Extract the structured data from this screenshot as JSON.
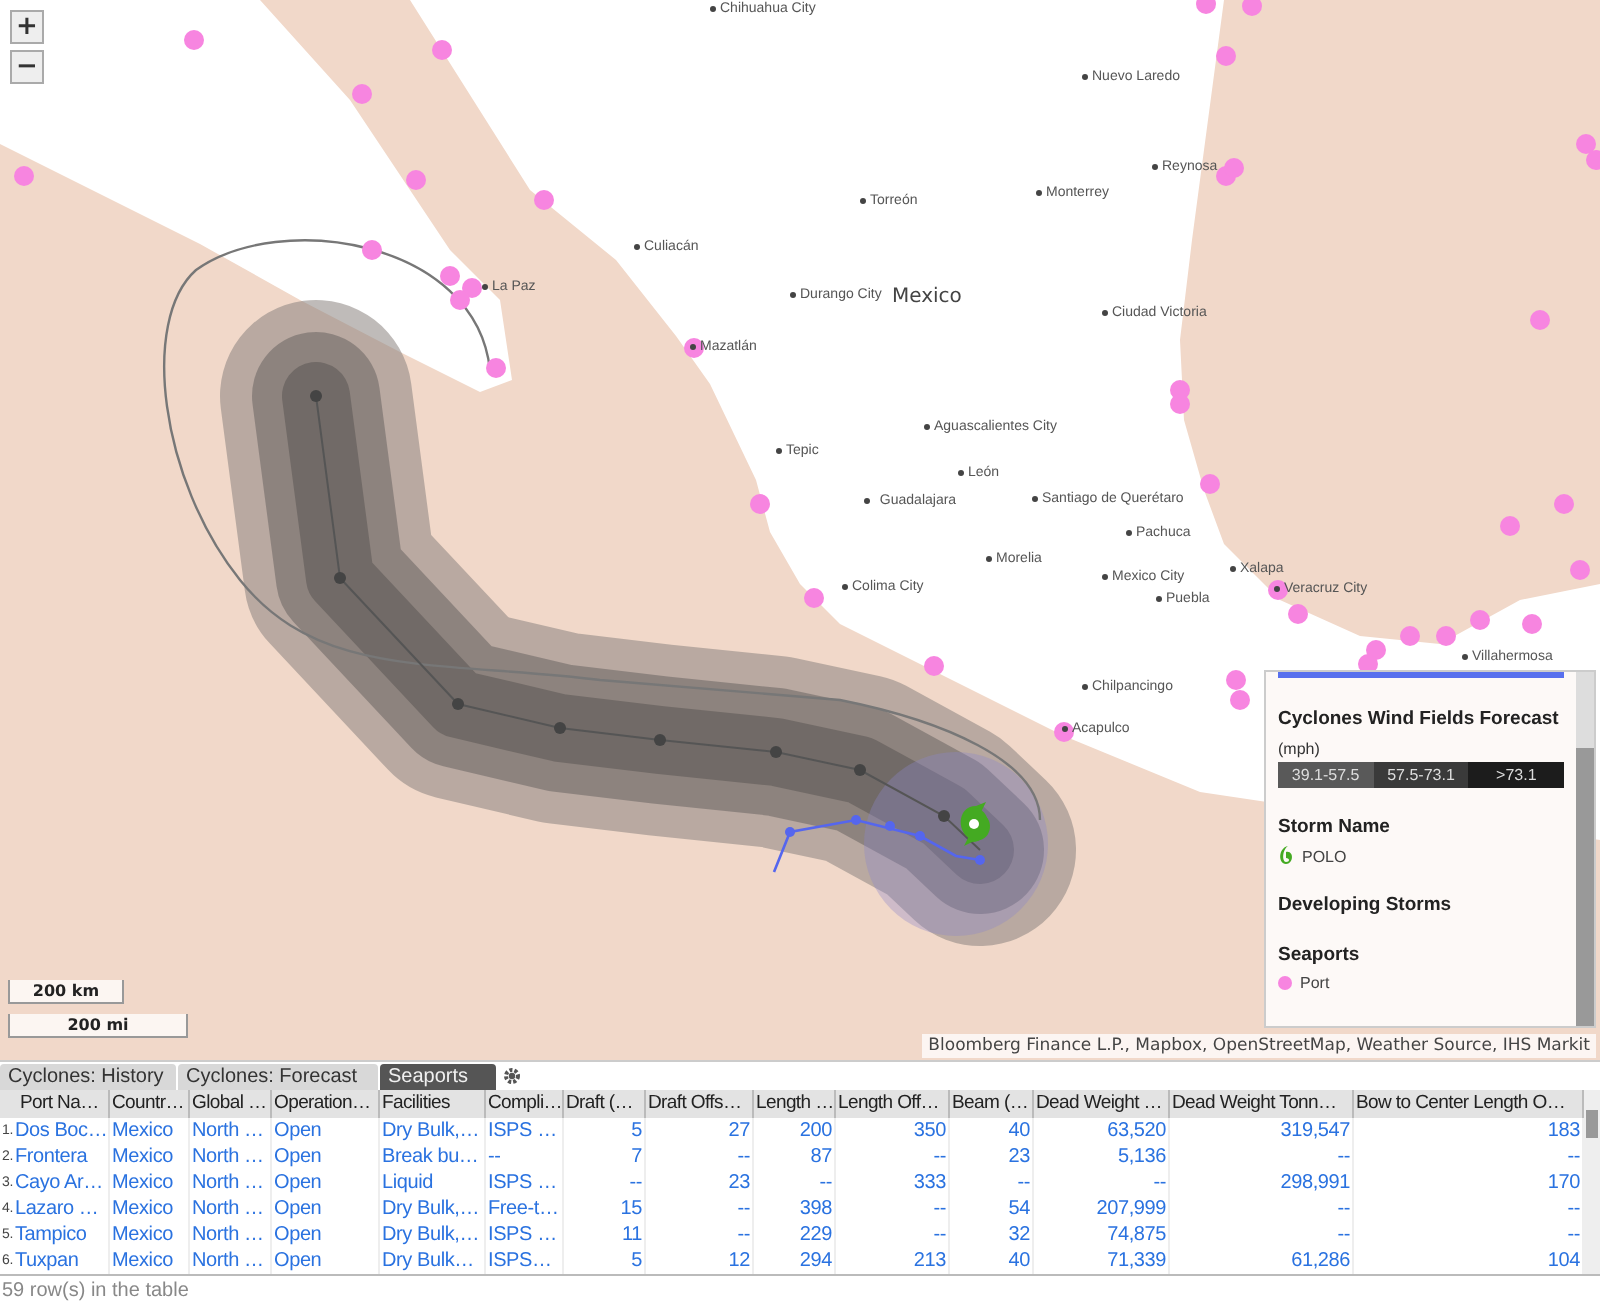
{
  "map": {
    "zoom_controls": [
      "+",
      "−"
    ],
    "cities": [
      "Chihuahua City",
      "Nuevo Laredo",
      "Torreón",
      "Monterrey",
      "Reynosa",
      "Culiacán",
      "La Paz",
      "Durango City",
      "Ciudad Victoria",
      "Mazatlán",
      "Tepic",
      "Aguascalientes City",
      "León",
      "Guadalajara",
      "Santiago de Querétaro",
      "Pachuca",
      "Morelia",
      "Mexico City",
      "Xalapa",
      "Veracruz City",
      "Puebla",
      "Colima City",
      "Chilpancingo",
      "Acapulco",
      "Villahermosa"
    ],
    "country_label": "Mexico",
    "scale_bars": [
      "200 km",
      "200 mi"
    ],
    "attribution": "Bloomberg Finance L.P., Mapbox, OpenStreetMap, Weather Source, IHS Markit"
  },
  "legend": {
    "title": "Cyclones Wind Fields Forecast",
    "unit": "(mph)",
    "bands": [
      {
        "label": "39.1-57.5",
        "color": "#595959"
      },
      {
        "label": "57.5-73.1",
        "color": "#3a3a3a"
      },
      {
        "label": ">73.1",
        "color": "#1c1c1c"
      }
    ],
    "storm_heading": "Storm Name",
    "storm": "POLO",
    "developing_heading": "Developing Storms",
    "seaports_heading": "Seaports",
    "port_label": "Port"
  },
  "table": {
    "tabs": [
      {
        "label": "Cyclones: History",
        "selected": false
      },
      {
        "label": "Cyclones: Forecast",
        "selected": false
      },
      {
        "label": "Seaports",
        "selected": true
      }
    ],
    "columns": [
      "Port Na…",
      "Countr…",
      "Global …",
      "Operation…",
      "Facilities",
      "Compli…",
      "Draft (…",
      "Draft Offs…",
      "Length …",
      "Length Off…",
      "Beam (…",
      "Dead Weight …",
      "Dead Weight Tonn…",
      "Bow to Center Length O…"
    ],
    "rows": [
      {
        "number": "1.",
        "cells": [
          "Dos Boc…",
          "Mexico",
          "North …",
          "Open",
          "Dry Bulk,…",
          "ISPS …",
          "5",
          "27",
          "200",
          "350",
          "40",
          "63,520",
          "319,547",
          "183"
        ]
      },
      {
        "number": "2.",
        "cells": [
          "Frontera",
          "Mexico",
          "North …",
          "Open",
          "Break bu…",
          "--",
          "7",
          "--",
          "87",
          "--",
          "23",
          "5,136",
          "--",
          "--"
        ]
      },
      {
        "number": "3.",
        "cells": [
          "Cayo Ar…",
          "Mexico",
          "North …",
          "Open",
          "Liquid",
          "ISPS …",
          "--",
          "23",
          "--",
          "333",
          "--",
          "--",
          "298,991",
          "170"
        ]
      },
      {
        "number": "4.",
        "cells": [
          "Lazaro …",
          "Mexico",
          "North …",
          "Open",
          "Dry Bulk,…",
          "Free-t…",
          "15",
          "--",
          "398",
          "--",
          "54",
          "207,999",
          "--",
          "--"
        ]
      },
      {
        "number": "5.",
        "cells": [
          "Tampico",
          "Mexico",
          "North …",
          "Open",
          "Dry Bulk,…",
          "ISPS …",
          "11",
          "--",
          "229",
          "--",
          "32",
          "74,875",
          "--",
          "--"
        ]
      },
      {
        "number": "6.",
        "cells": [
          "Tuxpan",
          "Mexico",
          "North …",
          "Open",
          "Dry Bulk…",
          "ISPS…",
          "5",
          "12",
          "294",
          "213",
          "40",
          "71,339",
          "61,286",
          "104"
        ]
      }
    ],
    "status": "59 row(s) in the table"
  }
}
